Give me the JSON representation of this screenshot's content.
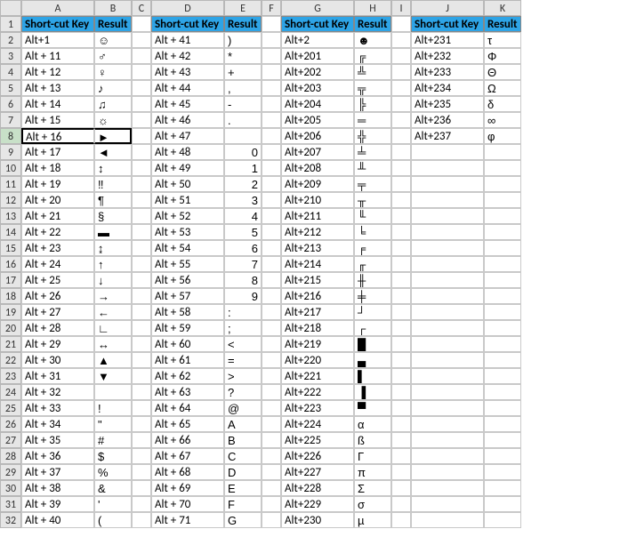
{
  "columns": [
    "A",
    "B",
    "C",
    "D",
    "E",
    "F",
    "G",
    "H",
    "I",
    "J",
    "K"
  ],
  "row_header": "",
  "headers": {
    "shortcut": "Short-cut Key",
    "result": "Result"
  },
  "selected_row": 8,
  "block1": [
    {
      "k": "Alt+1",
      "v": "☺"
    },
    {
      "k": "Alt + 11",
      "v": "♂"
    },
    {
      "k": "Alt + 12",
      "v": "♀"
    },
    {
      "k": "Alt + 13",
      "v": "♪"
    },
    {
      "k": "Alt + 14",
      "v": "♫"
    },
    {
      "k": "Alt + 15",
      "v": "☼"
    },
    {
      "k": "Alt + 16",
      "v": "►"
    },
    {
      "k": "Alt + 17",
      "v": "◄"
    },
    {
      "k": "Alt + 18",
      "v": "↕"
    },
    {
      "k": "Alt + 19",
      "v": "‼"
    },
    {
      "k": "Alt + 20",
      "v": "¶"
    },
    {
      "k": "Alt + 21",
      "v": "§"
    },
    {
      "k": "Alt + 22",
      "v": "▬"
    },
    {
      "k": "Alt + 23",
      "v": "↨"
    },
    {
      "k": "Alt + 24",
      "v": "↑"
    },
    {
      "k": "Alt + 25",
      "v": "↓"
    },
    {
      "k": "Alt + 26",
      "v": "→"
    },
    {
      "k": "Alt + 27",
      "v": "←"
    },
    {
      "k": "Alt + 28",
      "v": "∟"
    },
    {
      "k": "Alt + 29",
      "v": "↔"
    },
    {
      "k": "Alt + 30",
      "v": "▲"
    },
    {
      "k": "Alt + 31",
      "v": "▼"
    },
    {
      "k": "Alt + 32",
      "v": ""
    },
    {
      "k": "Alt + 33",
      "v": "!"
    },
    {
      "k": "Alt + 34",
      "v": "\""
    },
    {
      "k": "Alt + 35",
      "v": "#"
    },
    {
      "k": "Alt + 36",
      "v": "$"
    },
    {
      "k": "Alt + 37",
      "v": "%"
    },
    {
      "k": "Alt + 38",
      "v": "&"
    },
    {
      "k": "Alt + 39",
      "v": "'"
    },
    {
      "k": "Alt + 40",
      "v": "("
    }
  ],
  "block2": [
    {
      "k": "Alt + 41",
      "v": ")"
    },
    {
      "k": "Alt + 42",
      "v": "*"
    },
    {
      "k": "Alt + 43",
      "v": "+"
    },
    {
      "k": "Alt + 44",
      "v": ","
    },
    {
      "k": "Alt + 45",
      "v": "-"
    },
    {
      "k": "Alt + 46",
      "v": "."
    },
    {
      "k": "Alt + 47",
      "v": ""
    },
    {
      "k": "Alt + 48",
      "v": "0",
      "num": true
    },
    {
      "k": "Alt + 49",
      "v": "1",
      "num": true
    },
    {
      "k": "Alt + 50",
      "v": "2",
      "num": true
    },
    {
      "k": "Alt + 51",
      "v": "3",
      "num": true
    },
    {
      "k": "Alt + 52",
      "v": "4",
      "num": true
    },
    {
      "k": "Alt + 53",
      "v": "5",
      "num": true
    },
    {
      "k": "Alt + 54",
      "v": "6",
      "num": true
    },
    {
      "k": "Alt + 55",
      "v": "7",
      "num": true
    },
    {
      "k": "Alt + 56",
      "v": "8",
      "num": true
    },
    {
      "k": "Alt + 57",
      "v": "9",
      "num": true
    },
    {
      "k": "Alt + 58",
      "v": ":"
    },
    {
      "k": "Alt + 59",
      "v": ";"
    },
    {
      "k": "Alt + 60",
      "v": "<"
    },
    {
      "k": "Alt + 61",
      "v": "="
    },
    {
      "k": "Alt + 62",
      "v": ">"
    },
    {
      "k": "Alt + 63",
      "v": "?"
    },
    {
      "k": "Alt + 64",
      "v": "@"
    },
    {
      "k": "Alt + 65",
      "v": "A"
    },
    {
      "k": "Alt + 66",
      "v": "B"
    },
    {
      "k": "Alt + 67",
      "v": "C"
    },
    {
      "k": "Alt + 68",
      "v": "D"
    },
    {
      "k": "Alt + 69",
      "v": "E"
    },
    {
      "k": "Alt + 70",
      "v": "F"
    },
    {
      "k": "Alt + 71",
      "v": "G"
    }
  ],
  "block3": [
    {
      "k": "Alt+2",
      "v": "☻"
    },
    {
      "k": "Alt+201",
      "v": "╔"
    },
    {
      "k": "Alt+202",
      "v": "╩"
    },
    {
      "k": "Alt+203",
      "v": "╦"
    },
    {
      "k": "Alt+204",
      "v": "╠"
    },
    {
      "k": "Alt+205",
      "v": "═"
    },
    {
      "k": "Alt+206",
      "v": "╬"
    },
    {
      "k": "Alt+207",
      "v": "╧"
    },
    {
      "k": "Alt+208",
      "v": "╨"
    },
    {
      "k": "Alt+209",
      "v": "╤"
    },
    {
      "k": "Alt+210",
      "v": "╥"
    },
    {
      "k": "Alt+211",
      "v": "╙"
    },
    {
      "k": "Alt+212",
      "v": "╘"
    },
    {
      "k": "Alt+213",
      "v": "╒"
    },
    {
      "k": "Alt+214",
      "v": "╓"
    },
    {
      "k": "Alt+215",
      "v": "╫"
    },
    {
      "k": "Alt+216",
      "v": "╪"
    },
    {
      "k": "Alt+217",
      "v": "┘"
    },
    {
      "k": "Alt+218",
      "v": "┌"
    },
    {
      "k": "Alt+219",
      "v": "█"
    },
    {
      "k": "Alt+220",
      "v": "▄"
    },
    {
      "k": "Alt+221",
      "v": "▌"
    },
    {
      "k": "Alt+222",
      "v": "▐"
    },
    {
      "k": "Alt+223",
      "v": "▀"
    },
    {
      "k": "Alt+224",
      "v": "α"
    },
    {
      "k": "Alt+225",
      "v": "ß"
    },
    {
      "k": "Alt+226",
      "v": "Γ"
    },
    {
      "k": "Alt+227",
      "v": "π"
    },
    {
      "k": "Alt+228",
      "v": "Σ"
    },
    {
      "k": "Alt+229",
      "v": "σ"
    },
    {
      "k": "Alt+230",
      "v": "µ"
    }
  ],
  "block4": [
    {
      "k": "Alt+231",
      "v": "τ"
    },
    {
      "k": "Alt+232",
      "v": "Φ"
    },
    {
      "k": "Alt+233",
      "v": "Θ"
    },
    {
      "k": "Alt+234",
      "v": "Ω"
    },
    {
      "k": "Alt+235",
      "v": "δ"
    },
    {
      "k": "Alt+236",
      "v": "∞"
    },
    {
      "k": "Alt+237",
      "v": "φ"
    }
  ]
}
